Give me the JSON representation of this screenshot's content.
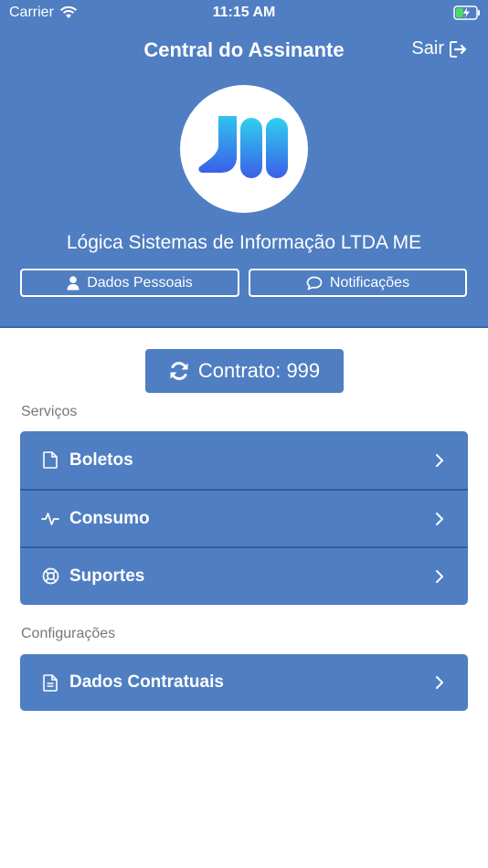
{
  "status_bar": {
    "carrier": "Carrier",
    "time": "11:15 AM"
  },
  "nav": {
    "title": "Central do Assinante",
    "logout_label": "Sair"
  },
  "profile": {
    "company_name": "Lógica Sistemas de Informação LTDA ME",
    "personal_data_label": "Dados Pessoais",
    "notifications_label": "Notificações"
  },
  "contract": {
    "label": "Contrato: 999"
  },
  "services": {
    "section_title": "Serviços",
    "items": [
      {
        "label": "Boletos",
        "icon": "file-icon"
      },
      {
        "label": "Consumo",
        "icon": "activity-icon"
      },
      {
        "label": "Suportes",
        "icon": "lifebuoy-icon"
      }
    ]
  },
  "settings": {
    "section_title": "Configurações",
    "items": [
      {
        "label": "Dados Contratuais",
        "icon": "document-text-icon"
      }
    ]
  },
  "colors": {
    "primary": "#4f7ec2",
    "divider": "#2f5e9f",
    "logo_gradient_top": "#2fd0ee",
    "logo_gradient_bottom": "#3b5fe8"
  }
}
